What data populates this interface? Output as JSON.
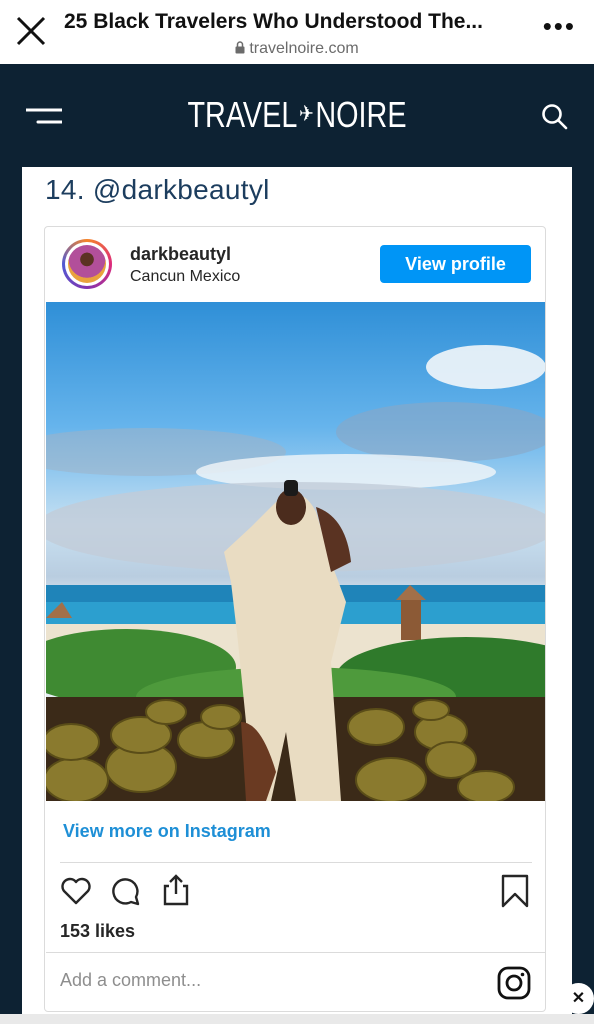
{
  "browser": {
    "title": "25 Black Travelers Who Understood The...",
    "url": "travelnoire.com"
  },
  "site": {
    "logo_left": "TRAVEL",
    "logo_right": "NOIRE"
  },
  "entry": {
    "heading": "14. @darkbeautyl"
  },
  "instagram": {
    "username": "darkbeautyl",
    "location": "Cancun Mexico",
    "view_profile": "View profile",
    "view_more": "View more on Instagram",
    "likes": "153 likes",
    "comment_placeholder": "Add a comment..."
  },
  "icons": {
    "close": "close-icon",
    "more": "more-icon",
    "menu": "menu-icon",
    "search": "search-icon",
    "like": "heart-icon",
    "comment": "comment-icon",
    "share": "share-icon",
    "save": "bookmark-icon",
    "instagram": "instagram-icon",
    "dismiss": "close-icon"
  },
  "colors": {
    "nav_background": "#0d2233",
    "heading": "#1c3d5e",
    "accent_blue": "#0095f6",
    "link_blue": "#1e8fd6"
  }
}
